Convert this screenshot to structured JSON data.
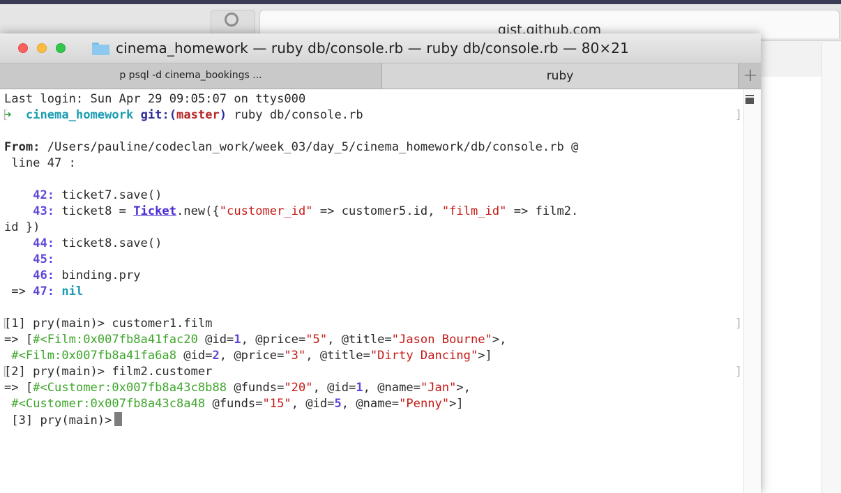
{
  "browser": {
    "url": "gist.github.com"
  },
  "window": {
    "title": "cinema_homework — ruby db/console.rb — ruby db/console.rb — 80×21",
    "folder_icon": "folder-icon",
    "traffic_lights": {
      "close": "#fc605c",
      "minimize": "#fdbc40",
      "zoom": "#34c84a"
    }
  },
  "tabs": [
    {
      "label": "p psql -d cinema_bookings ..."
    },
    {
      "label": "ruby"
    }
  ],
  "tab_add_label": "+",
  "terminal": {
    "login": "Last login: Sun Apr 29 09:05:07 on ttys000",
    "prompt": {
      "arrow": "➜",
      "dir": "cinema_homework",
      "git_prefix": "git:(",
      "branch": "master",
      "git_suffix": ")",
      "command": " ruby db/console.rb"
    },
    "from_label": "From:",
    "from_path": " /Users/pauline/codeclan_work/week_03/day_5/cinema_homework/db/console.rb @",
    "from_line": " line 47 :",
    "code": {
      "l42_num": "42:",
      "l42_code": " ticket7.save()",
      "l43_num": "43:",
      "l43_a": " ticket8 = ",
      "l43_class": "Ticket",
      "l43_b": ".new({",
      "l43_s1": "\"customer_id\"",
      "l43_c": " => customer5.id, ",
      "l43_s2": "\"film_id\"",
      "l43_d": " => film2.",
      "l43_wrap": "id })",
      "l44_num": "44:",
      "l44_code": " ticket8.save()",
      "l45_num": "45:",
      "l46_num": "46:",
      "l46_code": " binding.pry",
      "l47_arrow": " => ",
      "l47_num": "47:",
      "l47_code": "nil"
    },
    "q1": {
      "prompt": "[1] pry(main)>",
      "cmd": " customer1.film",
      "r1_pre": "=> [",
      "r1_obj": "#<Film:0x007fb8a41fac20",
      "r1_id_k": " @id=",
      "r1_id_v": "1",
      "r1_price_k": ", @price=",
      "r1_price_v": "\"5\"",
      "r1_title_k": ", @title=",
      "r1_title_v": "\"Jason Bourne\"",
      "r1_end": ">,",
      "r2_obj": "#<Film:0x007fb8a41fa6a8",
      "r2_id_k": " @id=",
      "r2_id_v": "2",
      "r2_price_k": ", @price=",
      "r2_price_v": "\"3\"",
      "r2_title_k": ", @title=",
      "r2_title_v": "\"Dirty Dancing\"",
      "r2_end": ">]"
    },
    "q2": {
      "prompt": "[2] pry(main)>",
      "cmd": " film2.customer",
      "r1_pre": "=> [",
      "r1_obj": "#<Customer:0x007fb8a43c8b88",
      "r1_funds_k": " @funds=",
      "r1_funds_v": "\"20\"",
      "r1_id_k": ", @id=",
      "r1_id_v": "1",
      "r1_name_k": ", @name=",
      "r1_name_v": "\"Jan\"",
      "r1_end": ">,",
      "r2_obj": "#<Customer:0x007fb8a43c8a48",
      "r2_funds_k": " @funds=",
      "r2_funds_v": "\"15\"",
      "r2_id_k": ", @id=",
      "r2_id_v": "5",
      "r2_name_k": ", @name=",
      "r2_name_v": "\"Penny\"",
      "r2_end": ">]"
    },
    "q3": {
      "prompt": "[3] pry(main)>"
    }
  }
}
